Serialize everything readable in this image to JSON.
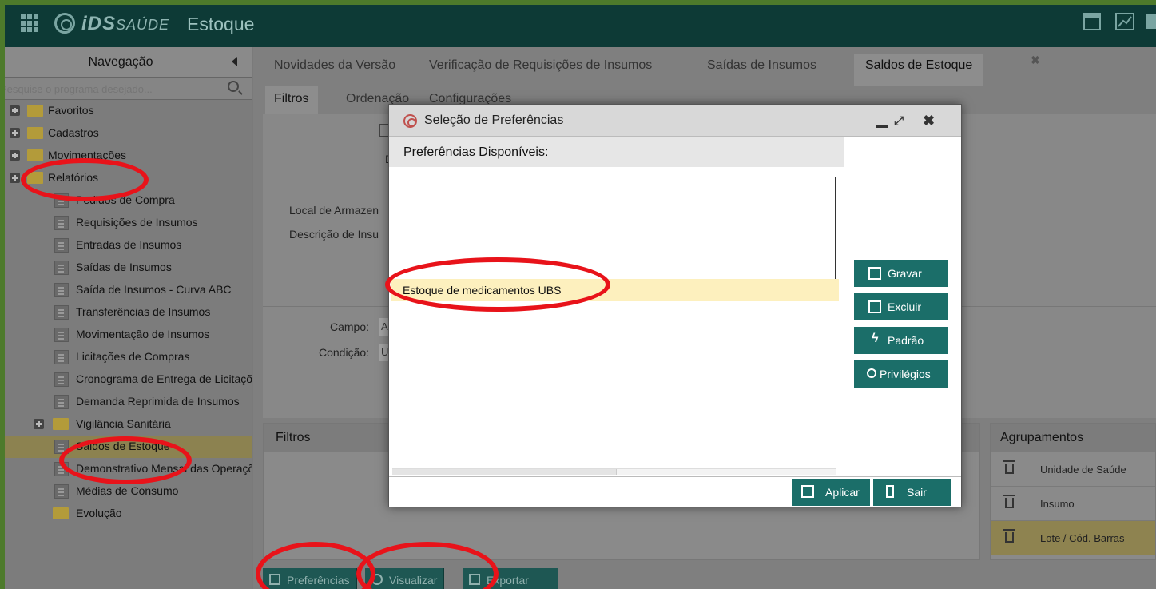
{
  "header": {
    "brand": "iDS",
    "brand_sub": "SAÚDE",
    "module": "Estoque"
  },
  "sidebar": {
    "title": "Navegação",
    "search_placeholder": "Pesquise o programa desejado...",
    "items": [
      {
        "label": "Favoritos"
      },
      {
        "label": "Cadastros"
      },
      {
        "label": "Movimentações"
      },
      {
        "label": "Relatórios"
      },
      {
        "label": "Pedidos de Compra"
      },
      {
        "label": "Requisições de Insumos"
      },
      {
        "label": "Entradas de Insumos"
      },
      {
        "label": "Saídas de Insumos"
      },
      {
        "label": "Saída de Insumos - Curva ABC"
      },
      {
        "label": "Transferências de Insumos"
      },
      {
        "label": "Movimentação de Insumos"
      },
      {
        "label": "Licitações de Compras"
      },
      {
        "label": "Cronograma de Entrega de Licitações"
      },
      {
        "label": "Demanda Reprimida de Insumos"
      },
      {
        "label": "Vigilância Sanitária"
      },
      {
        "label": "Saldos de Estoque"
      },
      {
        "label": "Demonstrativo Mensal das Operações"
      },
      {
        "label": "Médias de Consumo"
      },
      {
        "label": "Evolução"
      }
    ]
  },
  "tabs": [
    {
      "label": "Novidades da Versão"
    },
    {
      "label": "Verificação de Requisições de Insumos"
    },
    {
      "label": "Saídas de Insumos"
    },
    {
      "label": "Saldos de Estoque"
    }
  ],
  "subtabs": [
    {
      "label": "Filtros"
    },
    {
      "label": "Ordenação"
    },
    {
      "label": "Configurações"
    }
  ],
  "form": {
    "local_label": "Local de Armazen",
    "descricao_label": "Descrição de Insu",
    "campo_label": "Campo:",
    "campo_value": "A",
    "condicao_label": "Condição:",
    "condicao_value": "U",
    "small_label": "D"
  },
  "filtros_panel": {
    "title": "Filtros"
  },
  "agrupamentos": {
    "title": "Agrupamentos",
    "rows": [
      {
        "label": "Unidade de Saúde"
      },
      {
        "label": "Insumo"
      },
      {
        "label": "Lote / Cód. Barras"
      }
    ]
  },
  "bottom_bar": {
    "preferencias": "Preferências",
    "visualizar": "Visualizar",
    "exportar": "Exportar"
  },
  "modal": {
    "title": "Seleção de Preferências",
    "list_header": "Preferências Disponíveis:",
    "items": [
      {
        "label": "Estoque de medicamentos UBS",
        "selected": true
      }
    ],
    "actions": {
      "gravar": "Gravar",
      "excluir": "Excluir",
      "padrao": "Padrão",
      "privilegios": "Privilégios"
    },
    "footer": {
      "aplicar": "Aplicar",
      "sair": "Sair"
    }
  },
  "colors": {
    "frame": "#4d7a2b",
    "header_bg": "#0d3a36",
    "button_teal": "#1b6e69",
    "selected_item": "#fdf0be",
    "annotation_red": "#e8131a"
  }
}
